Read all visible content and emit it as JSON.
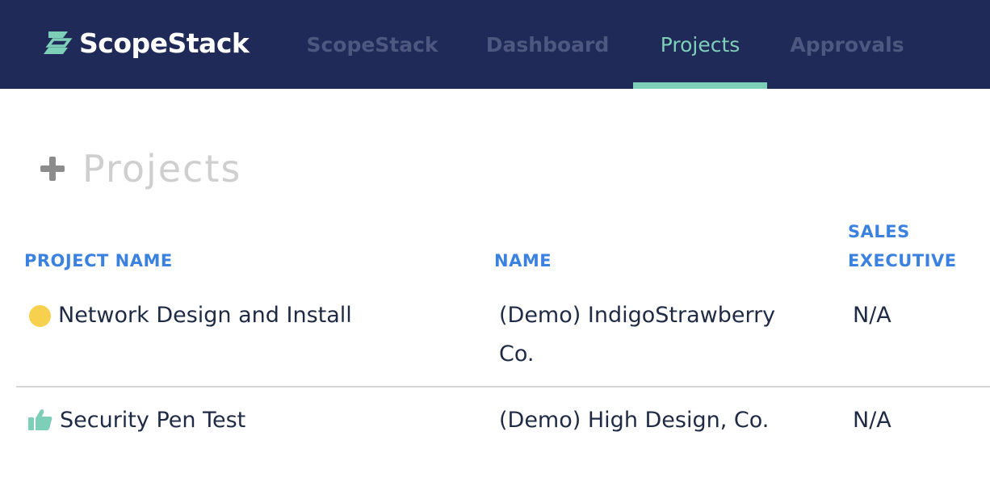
{
  "brand": {
    "name": "ScopeStack"
  },
  "nav": {
    "items": [
      {
        "label": "ScopeStack"
      },
      {
        "label": "Dashboard"
      },
      {
        "label": "Projects"
      },
      {
        "label": "Approvals"
      }
    ],
    "active": "Projects"
  },
  "page": {
    "title": "Projects"
  },
  "table": {
    "headers": {
      "project_name": "PROJECT NAME",
      "name": "NAME",
      "sales_executive_line1": "SALES",
      "sales_executive_line2": "EXECUTIVE"
    },
    "rows": [
      {
        "status_icon": "yellow-dot-icon",
        "project_name": "Network Design and Install",
        "name_line1": "(Demo) IndigoStrawberry",
        "name_line2": "Co.",
        "sales_executive": "N/A"
      },
      {
        "status_icon": "thumbs-up-icon",
        "project_name": "Security Pen Test",
        "name_line1": "(Demo) High Design, Co.",
        "sales_executive": "N/A"
      }
    ]
  },
  "colors": {
    "nav_background": "#1f2a58",
    "nav_active": "#7ecfb8",
    "nav_inactive": "#4d5780",
    "header_blue": "#3b82e0",
    "status_yellow": "#f7d04d",
    "status_green": "#7ecfb8"
  }
}
